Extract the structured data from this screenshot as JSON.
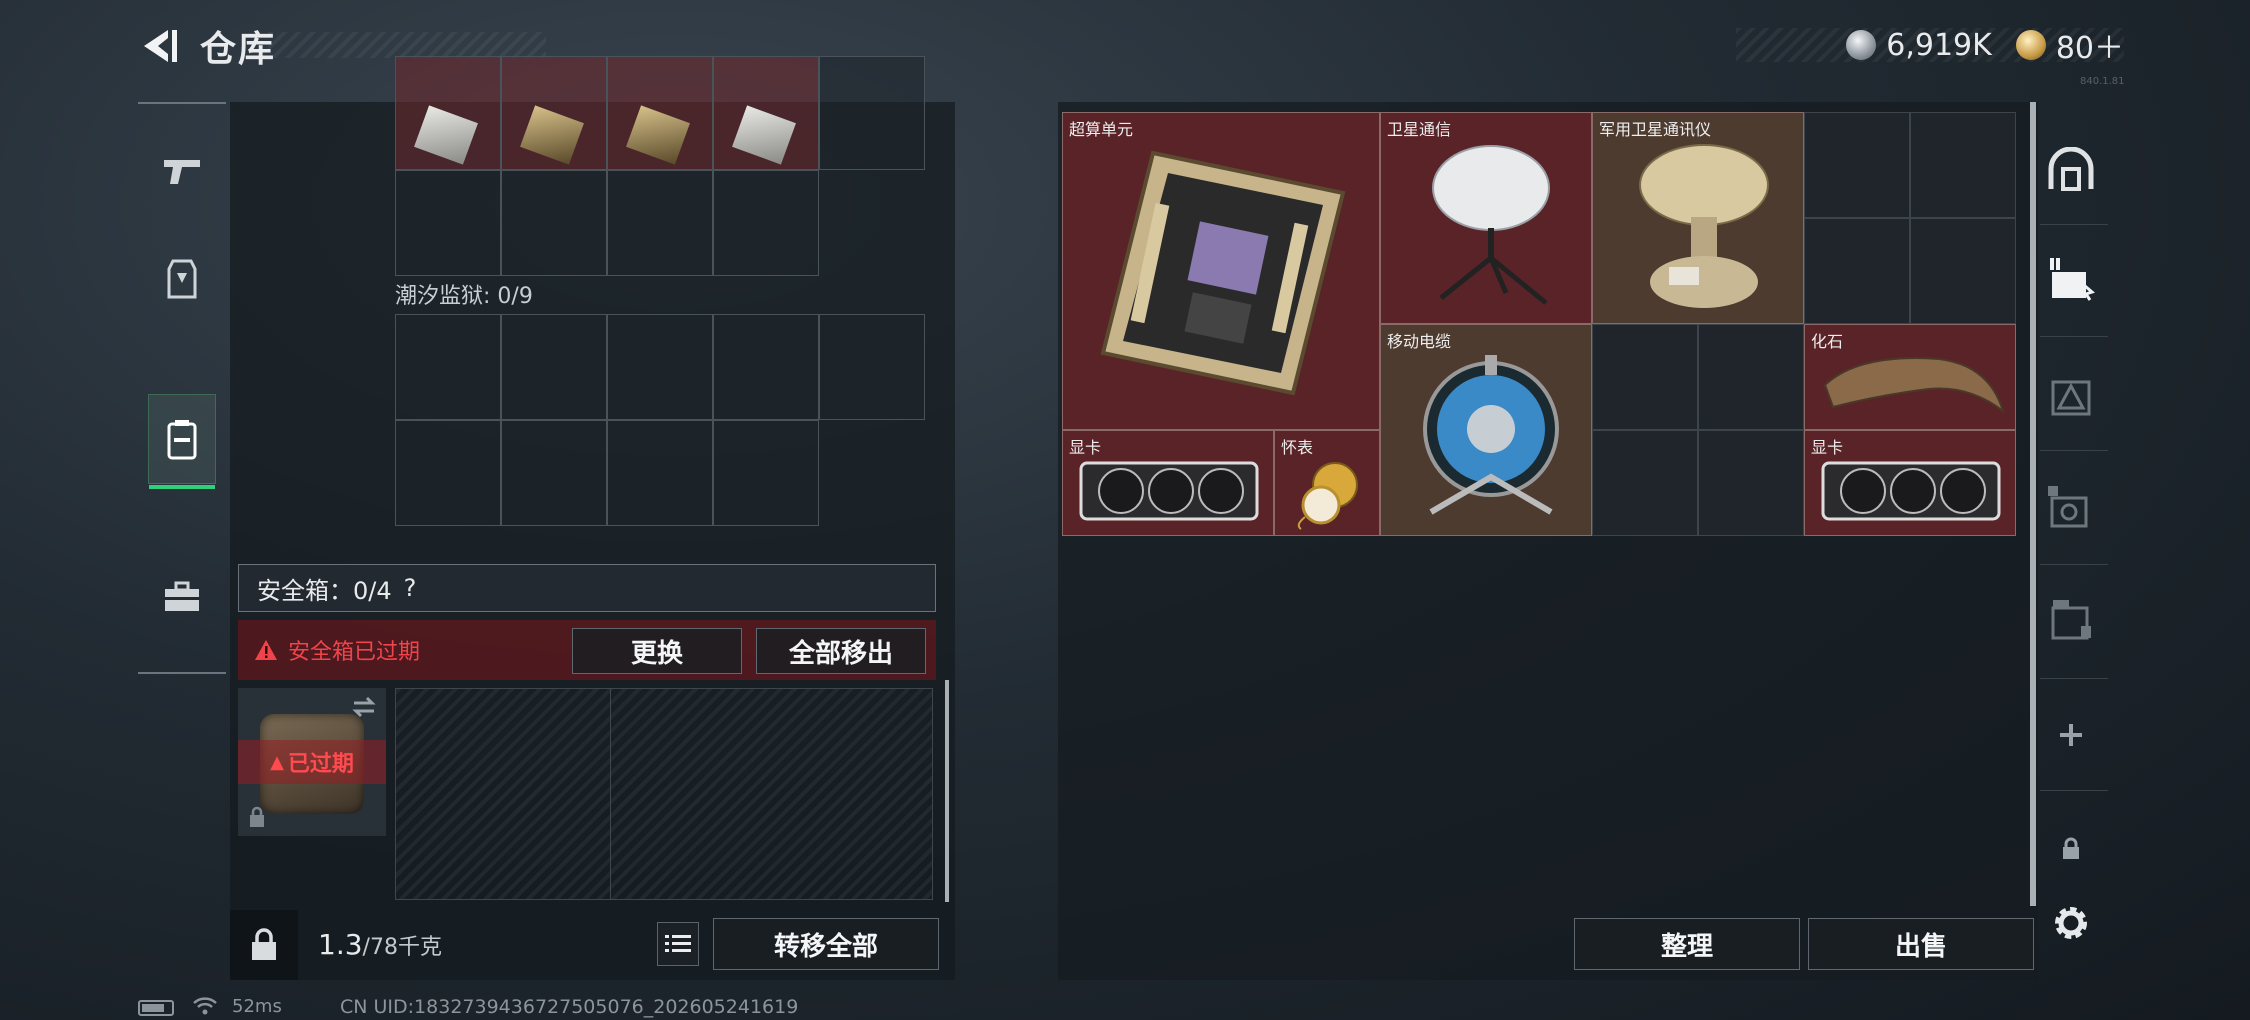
{
  "header": {
    "title": "仓库",
    "currency_primary": "6,919K",
    "currency_secondary": "80＋",
    "corner_tag": "840.1.81"
  },
  "left": {
    "section_label": "潮汐监狱: 0/9",
    "safe_box": {
      "title": "安全箱：0/4",
      "help": "?",
      "warning": "安全箱已过期",
      "replace_label": "更换",
      "move_all_label": "全部移出",
      "expired_badge": "已过期"
    },
    "weight": {
      "current": "1.3",
      "capacity": "/78千克"
    },
    "transfer_all_label": "转移全部"
  },
  "right": {
    "items": [
      {
        "name": "超算单元",
        "color": "red"
      },
      {
        "name": "卫星通信",
        "color": "red"
      },
      {
        "name": "军用卫星通讯仪",
        "color": "brown"
      },
      {
        "name": "移动电缆",
        "color": "brown"
      },
      {
        "name": "化石",
        "color": "red"
      },
      {
        "name": "显卡",
        "color": "red"
      },
      {
        "name": "怀表",
        "color": "red"
      },
      {
        "name": "显卡",
        "color": "red"
      }
    ],
    "sort_label": "整理",
    "sell_label": "出售"
  },
  "status_bar": {
    "ping": "52ms",
    "uid": "CN UID:18327394367275050​76_202605241619"
  },
  "colors": {
    "accent_green": "#2fd07c",
    "warning_red": "#f0444a",
    "item_red_bg": "#5a2328",
    "item_brown_bg": "#4d3b30"
  },
  "icons": {
    "back": "back-arrow-icon",
    "nav": [
      "gun-icon",
      "vest-icon",
      "backpack-icon",
      "toolbox-icon"
    ],
    "rail": [
      "dome-icon",
      "stash-2-icon",
      "stash-3-icon",
      "stash-4-icon",
      "stash-5-icon",
      "plus-icon",
      "lock-icon",
      "gear-icon"
    ]
  }
}
